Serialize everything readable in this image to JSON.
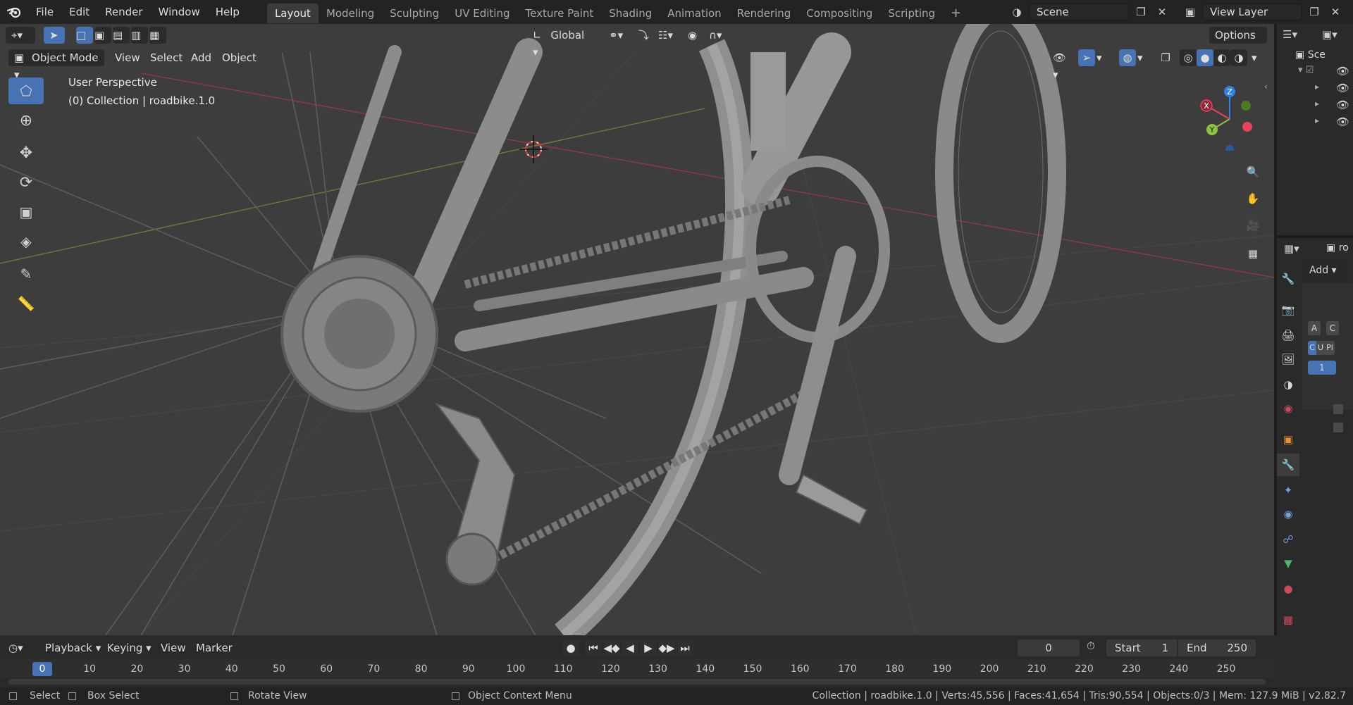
{
  "topbar": {
    "menus": [
      "File",
      "Edit",
      "Render",
      "Window",
      "Help"
    ],
    "workspaces": [
      "Layout",
      "Modeling",
      "Sculpting",
      "UV Editing",
      "Texture Paint",
      "Shading",
      "Animation",
      "Rendering",
      "Compositing",
      "Scripting"
    ],
    "active_workspace": "Layout",
    "scene": "Scene",
    "view_layer": "View Layer"
  },
  "viewport": {
    "mode": "Object Mode",
    "menus": [
      "View",
      "Select",
      "Add",
      "Object"
    ],
    "transform_orientation": "Global",
    "options_label": "Options",
    "overlay_title": "User Perspective",
    "overlay_subtitle": "(0) Collection | roadbike.1.0"
  },
  "gizmo": {
    "x": "X",
    "y": "Y",
    "z": "Z"
  },
  "outliner": {
    "scene_label": "Sce"
  },
  "properties": {
    "object_label": "ro",
    "add_label": "Add",
    "row1": [
      "A",
      "C"
    ],
    "row2": [
      "C",
      "U",
      "Pl"
    ],
    "value": "1"
  },
  "timeline": {
    "menus": [
      "Playback",
      "Keying",
      "View",
      "Marker"
    ],
    "current_frame": "0",
    "start_label": "Start",
    "start_value": "1",
    "end_label": "End",
    "end_value": "250",
    "ticks": [
      "0",
      "10",
      "20",
      "30",
      "40",
      "50",
      "60",
      "70",
      "80",
      "90",
      "100",
      "110",
      "120",
      "130",
      "140",
      "150",
      "160",
      "170",
      "180",
      "190",
      "200",
      "210",
      "220",
      "230",
      "240",
      "250"
    ]
  },
  "statusbar": {
    "select": "Select",
    "box_select": "Box Select",
    "rotate_view": "Rotate View",
    "context_menu": "Object Context Menu",
    "stats": "Collection | roadbike.1.0 | Verts:45,556 | Faces:41,654 | Tris:90,554 | Objects:0/3 | Mem: 127.9 MiB | v2.82.7"
  },
  "colors": {
    "accent": "#4772b3",
    "axis_x": "#e8435a",
    "axis_y": "#8bc43f",
    "axis_z": "#2f83e6",
    "frame_indicator": "#4772b3"
  }
}
